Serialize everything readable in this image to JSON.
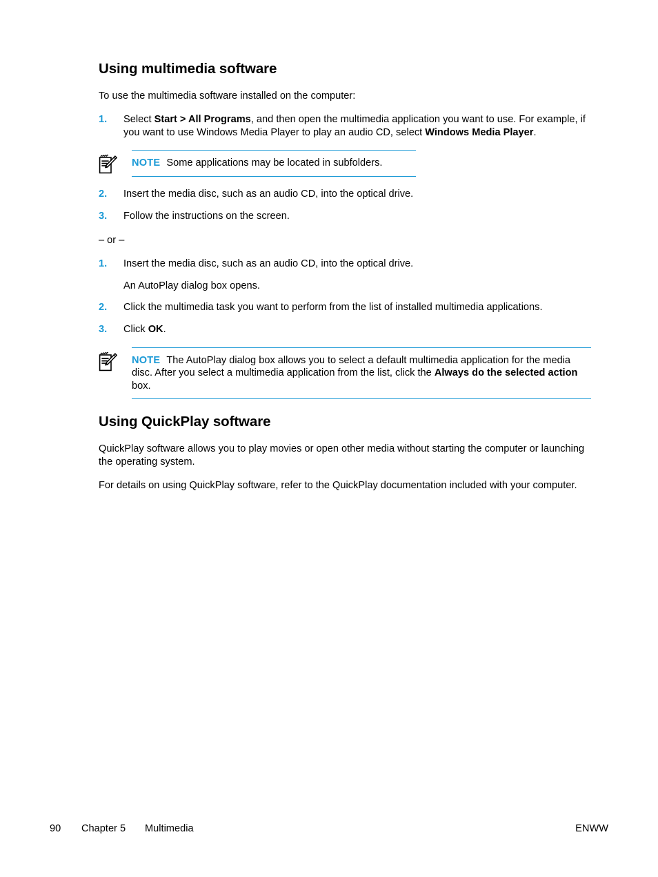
{
  "document": {
    "section1": {
      "heading": "Using multimedia software",
      "intro": "To use the multimedia software installed on the computer:",
      "list_a": [
        {
          "num": "1.",
          "parts": [
            {
              "text": "Select ",
              "bold": false
            },
            {
              "text": "Start > All Programs",
              "bold": true
            },
            {
              "text": ", and then open the multimedia application you want to use. For example, if you want to use Windows Media Player to play an audio CD, select ",
              "bold": false
            },
            {
              "text": "Windows Media Player",
              "bold": true
            },
            {
              "text": ".",
              "bold": false
            }
          ]
        }
      ],
      "note1": {
        "icon": "note-pencil-icon",
        "label": "NOTE",
        "parts": [
          {
            "text": "Some applications may be located in subfolders.",
            "bold": false
          }
        ]
      },
      "list_b": [
        {
          "num": "2.",
          "parts": [
            {
              "text": "Insert the media disc, such as an audio CD, into the optical drive.",
              "bold": false
            }
          ]
        },
        {
          "num": "3.",
          "parts": [
            {
              "text": "Follow the instructions on the screen.",
              "bold": false
            }
          ]
        }
      ],
      "or_divider": "– or –",
      "list_c": [
        {
          "num": "1.",
          "parts": [
            {
              "text": "Insert the media disc, such as an audio CD, into the optical drive.",
              "bold": false
            }
          ],
          "sub": "An AutoPlay dialog box opens."
        },
        {
          "num": "2.",
          "parts": [
            {
              "text": "Click the multimedia task you want to perform from the list of installed multimedia applications.",
              "bold": false
            }
          ]
        },
        {
          "num": "3.",
          "parts": [
            {
              "text": "Click ",
              "bold": false
            },
            {
              "text": "OK",
              "bold": true
            },
            {
              "text": ".",
              "bold": false
            }
          ]
        }
      ],
      "note2": {
        "icon": "note-pencil-icon",
        "label": "NOTE",
        "parts": [
          {
            "text": "The AutoPlay dialog box allows you to select a default multimedia application for the media disc. After you select a multimedia application from the list, click the ",
            "bold": false
          },
          {
            "text": "Always do the selected action",
            "bold": true
          },
          {
            "text": " box.",
            "bold": false
          }
        ]
      }
    },
    "section2": {
      "heading": "Using QuickPlay software",
      "paragraphs": [
        "QuickPlay software allows you to play movies or open other media without starting the computer or launching the operating system.",
        "For details on using QuickPlay software, refer to the QuickPlay documentation included with your computer."
      ]
    },
    "footer": {
      "page_number": "90",
      "chapter": "Chapter 5",
      "chapter_title": "Multimedia",
      "locale_code": "ENWW"
    },
    "colors": {
      "accent": "#1C9AD6",
      "text": "#000000",
      "background": "#FFFFFF"
    }
  }
}
